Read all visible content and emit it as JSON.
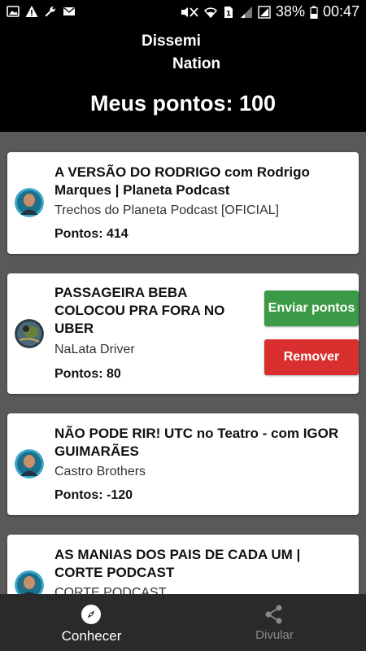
{
  "status_bar": {
    "left_icons": [
      "image-icon",
      "warning-icon",
      "wrench-icon",
      "mail-icon"
    ],
    "right_icons": [
      "mute-icon",
      "wifi-icon",
      "sim-icon",
      "signal-icon",
      "signal-icon",
      "battery-icon"
    ],
    "battery": "38%",
    "time": "00:47"
  },
  "header": {
    "brand_line1": "Dissemi",
    "brand_line2": "Nation",
    "points_label": "Meus pontos:  100"
  },
  "videos": [
    {
      "title_lines": [
        "A VERSÃO DO RODRIGO com Rodrigo",
        "Marques | Planeta Podcast"
      ],
      "channel": "Trechos do Planeta Podcast [OFICIAL]",
      "points": "Pontos: 414"
    },
    {
      "title_lines": [
        "PASSAGEIRA BEBA",
        "COLOCOU PRA FORA NO",
        "UBER"
      ],
      "channel": "NaLata Driver",
      "points": "Pontos: 80",
      "actions": {
        "send": "Enviar pontos",
        "remove": "Remover"
      }
    },
    {
      "title_lines": [
        "NÃO PODE RIR! UTC no Teatro - com IGOR",
        "GUIMARÃES"
      ],
      "channel": "Castro Brothers",
      "points": "Pontos: -120"
    },
    {
      "title_lines": [
        "AS MANIAS DOS PAIS DE CADA UM |",
        "CORTE PODCAST"
      ],
      "channel": "CORTE PODCAST"
    }
  ],
  "bottom_nav": {
    "items": [
      {
        "label": "Conhecer",
        "icon": "compass-icon",
        "active": true
      },
      {
        "label": "Divular",
        "icon": "share-icon",
        "active": false
      }
    ]
  },
  "colors": {
    "background": "#595959",
    "header": "#000000",
    "send_button": "#3a9a45",
    "remove_button": "#d9302f",
    "nav_background": "#2a2a2a",
    "nav_active": "#ffffff",
    "nav_inactive": "#8a8a8a"
  }
}
